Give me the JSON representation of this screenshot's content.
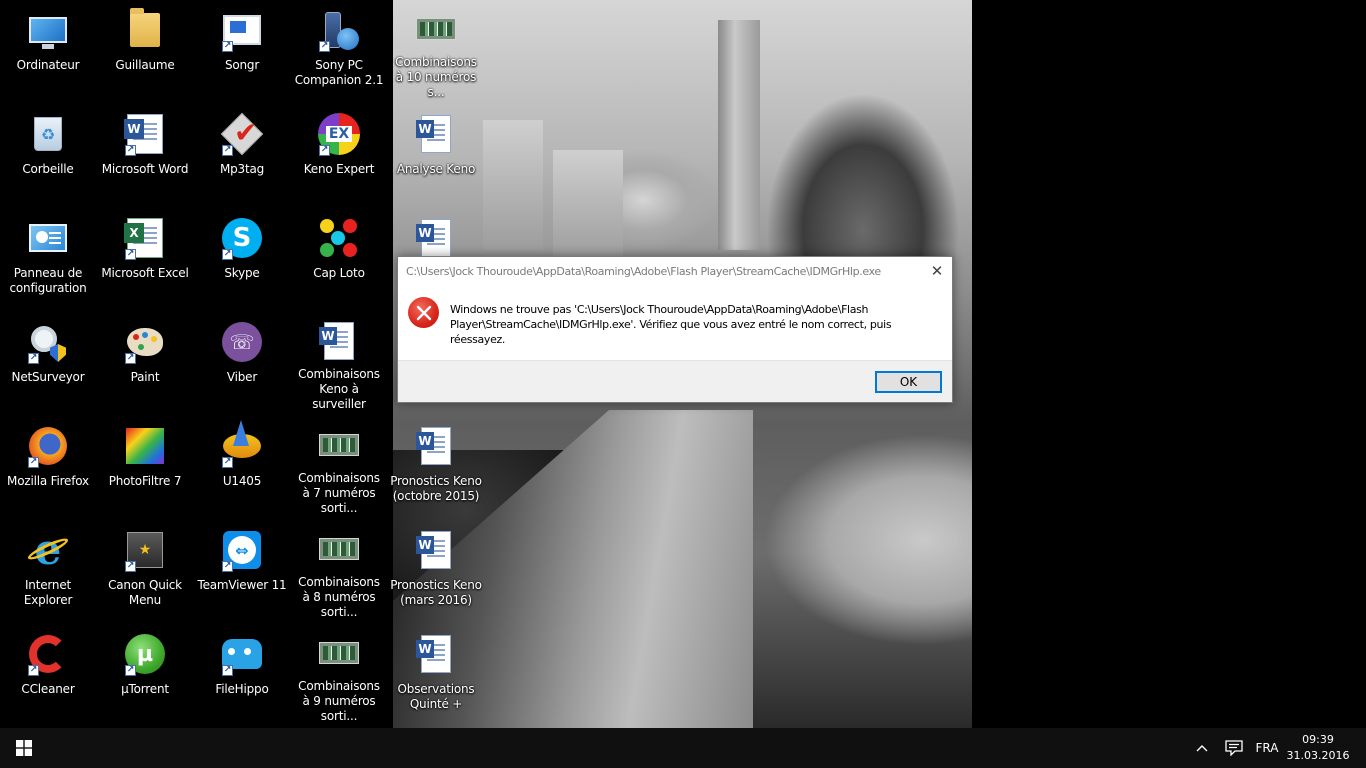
{
  "desktop": {
    "icons": [
      {
        "label": "Ordinateur",
        "icon": "computer-icon"
      },
      {
        "label": "Corbeille",
        "icon": "recycle-bin-icon"
      },
      {
        "label": "Panneau de configuration",
        "icon": "control-panel-icon"
      },
      {
        "label": "NetSurveyor",
        "icon": "netsurveyor-icon"
      },
      {
        "label": "Mozilla Firefox",
        "icon": "firefox-icon"
      },
      {
        "label": "Internet Explorer",
        "icon": "internet-explorer-icon"
      },
      {
        "label": "CCleaner",
        "icon": "ccleaner-icon"
      },
      {
        "label": "Guillaume",
        "icon": "folder-icon"
      },
      {
        "label": "Microsoft Word",
        "icon": "word-icon"
      },
      {
        "label": "Microsoft Excel",
        "icon": "excel-icon"
      },
      {
        "label": "Paint",
        "icon": "paint-icon"
      },
      {
        "label": "PhotoFiltre 7",
        "icon": "photofiltre-icon"
      },
      {
        "label": "Canon Quick Menu",
        "icon": "canon-icon"
      },
      {
        "label": "µTorrent",
        "icon": "utorrent-icon"
      },
      {
        "label": "Songr",
        "icon": "songr-icon"
      },
      {
        "label": "Mp3tag",
        "icon": "mp3tag-icon"
      },
      {
        "label": "Skype",
        "icon": "skype-icon"
      },
      {
        "label": "Viber",
        "icon": "viber-icon"
      },
      {
        "label": "U1405",
        "icon": "u1405-icon"
      },
      {
        "label": "TeamViewer 11",
        "icon": "teamviewer-icon"
      },
      {
        "label": "FileHippo",
        "icon": "filehippo-icon"
      },
      {
        "label": "Sony PC Companion 2.1",
        "icon": "sony-pc-companion-icon"
      },
      {
        "label": "Keno Expert",
        "icon": "keno-expert-icon"
      },
      {
        "label": "Cap Loto",
        "icon": "cap-loto-icon"
      },
      {
        "label": "Combinaisons Keno à surveiller",
        "icon": "word-document-icon"
      },
      {
        "label": "Combinaisons à 7 numéros sorti...",
        "icon": "spreadsheet-thumbnail-icon"
      },
      {
        "label": "Combinaisons à 8 numéros sorti...",
        "icon": "spreadsheet-thumbnail-icon"
      },
      {
        "label": "Combinaisons à 9 numéros sorti...",
        "icon": "spreadsheet-thumbnail-icon"
      },
      {
        "label": "Combinaisons à 10 numéros s...",
        "icon": "spreadsheet-thumbnail-icon"
      },
      {
        "label": "Analyse Keno",
        "icon": "word-document-icon"
      },
      {
        "label": "",
        "icon": "word-document-icon"
      },
      {
        "label": "Pronostics Keno (octobre 2015)",
        "icon": "word-document-icon"
      },
      {
        "label": "Pronostics Keno (mars 2016)",
        "icon": "word-document-icon"
      },
      {
        "label": "Observations Quinté +",
        "icon": "word-document-icon"
      }
    ]
  },
  "dialog": {
    "title": "C:\\Users\\Jock Thouroude\\AppData\\Roaming\\Adobe\\Flash Player\\StreamCache\\IDMGrHlp.exe",
    "message": "Windows ne trouve pas 'C:\\Users\\Jock Thouroude\\AppData\\Roaming\\Adobe\\Flash Player\\StreamCache\\IDMGrHlp.exe'. Vérifiez que vous avez entré le nom correct, puis réessayez.",
    "close_glyph": "✕",
    "ok_label": "OK",
    "error_icon": "error-icon"
  },
  "taskbar": {
    "start_icon": "windows-start-icon",
    "tray_chevron": "^",
    "notification_icon": "action-center-icon",
    "language": "FRA",
    "time": "09:39",
    "date": "31.03.2016"
  },
  "colors": {
    "taskbar_bg": "#101010",
    "accent": "#0078d7",
    "error_red": "#d8261b"
  }
}
